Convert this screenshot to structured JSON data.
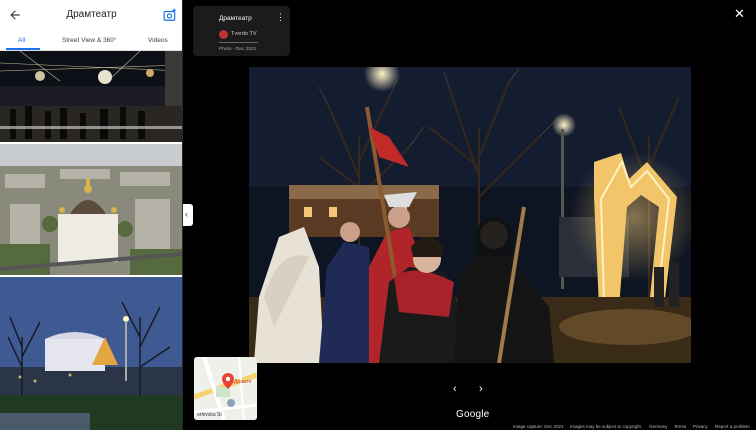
{
  "header": {
    "title": "Драмтеатр"
  },
  "tabs": [
    {
      "label": "All",
      "active": true
    },
    {
      "label": "Street View & 360°",
      "active": false
    },
    {
      "label": "Videos",
      "active": false
    }
  ],
  "info_card": {
    "title": "Драмтеатр",
    "author": "Tverdo TV",
    "date": "Photo - Dec 2021"
  },
  "minimap": {
    "label": "Драмте",
    "street": "orhivska St"
  },
  "brand": "Google",
  "footer": {
    "capture": "Image capture: Dec 2021",
    "copyright": "Images may be subject to copyright.",
    "country": "Germany",
    "terms": "Terms",
    "privacy": "Privacy",
    "report": "Report a problem"
  },
  "colors": {
    "accent": "#1a73e8",
    "viewer_bg": "#000000",
    "card_bg": "#1b1b1b"
  },
  "icons": [
    "back-arrow-icon",
    "add-photo-icon",
    "collapse-chevron-icon",
    "more-vert-icon",
    "close-icon",
    "chevron-left-icon",
    "chevron-right-icon",
    "map-pin-icon"
  ]
}
